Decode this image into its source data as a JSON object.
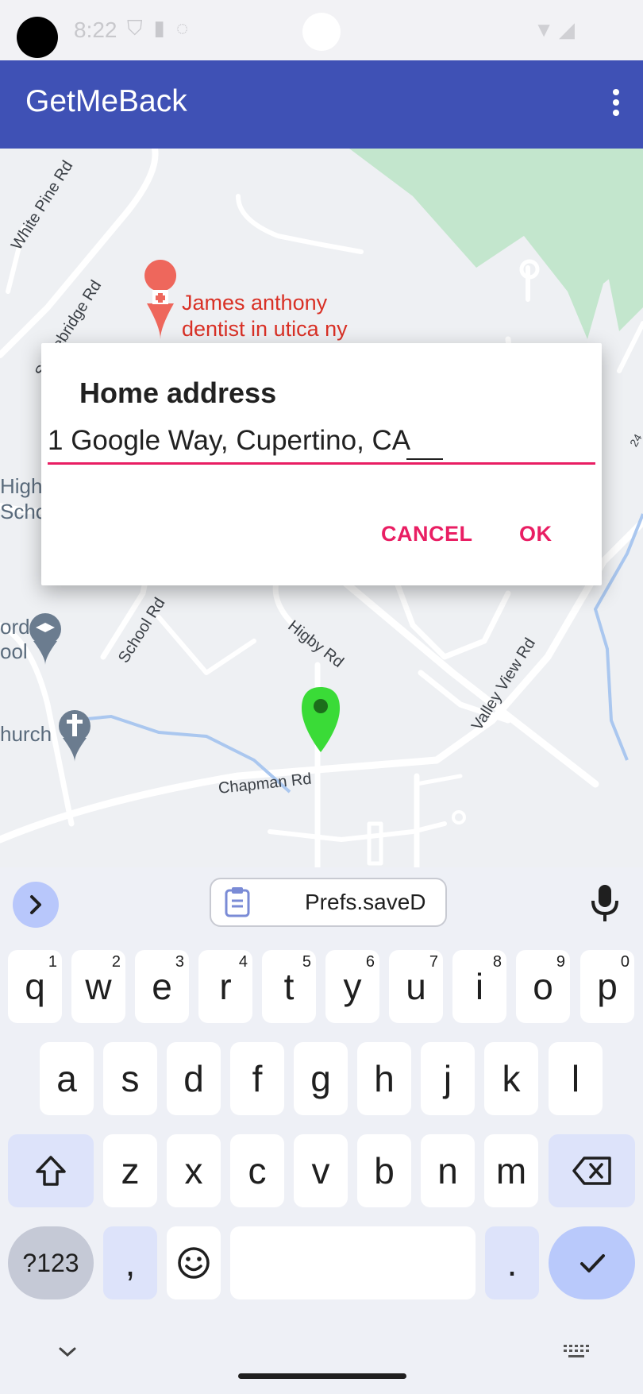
{
  "status_bar": {
    "time": "8:22",
    "icons": [
      "shield-icon",
      "sd-card-icon",
      "sync-icon"
    ]
  },
  "app_bar": {
    "title": "GetMeBack",
    "overflow_icon": "more-vert-icon"
  },
  "map": {
    "labels": {
      "white_pine": "White Pine Rd",
      "stonebridge": "Stonebridge Rd",
      "school_rd": "School Rd",
      "higby": "Higby Rd",
      "valley_view": "Valley View Rd",
      "chapman": "Chapman Rd",
      "high_school_1": "High",
      "high_school_2": "Scho",
      "ford_1": "ord",
      "ford_2": "ool",
      "church": "hurch",
      "route": "24"
    },
    "poi": {
      "line1": "James anthony",
      "line2": "dentist in utica ny"
    },
    "marker_color": "#3adb37"
  },
  "dialog": {
    "title": "Home address",
    "input_value": "1 Google Way, Cupertino, CA",
    "cancel": "CANCEL",
    "ok": "OK",
    "accent": "#e91e63"
  },
  "keyboard": {
    "suggestion": "Prefs.saveD",
    "row1": [
      {
        "k": "q",
        "h": "1"
      },
      {
        "k": "w",
        "h": "2"
      },
      {
        "k": "e",
        "h": "3"
      },
      {
        "k": "r",
        "h": "4"
      },
      {
        "k": "t",
        "h": "5"
      },
      {
        "k": "y",
        "h": "6"
      },
      {
        "k": "u",
        "h": "7"
      },
      {
        "k": "i",
        "h": "8"
      },
      {
        "k": "o",
        "h": "9"
      },
      {
        "k": "p",
        "h": "0"
      }
    ],
    "row2": [
      "a",
      "s",
      "d",
      "f",
      "g",
      "h",
      "j",
      "k",
      "l"
    ],
    "row3": [
      "z",
      "x",
      "c",
      "v",
      "b",
      "n",
      "m"
    ],
    "symbols": "?123",
    "comma": ",",
    "period": "."
  },
  "colors": {
    "app_bar": "#3f51b5",
    "accent": "#e91e63"
  }
}
